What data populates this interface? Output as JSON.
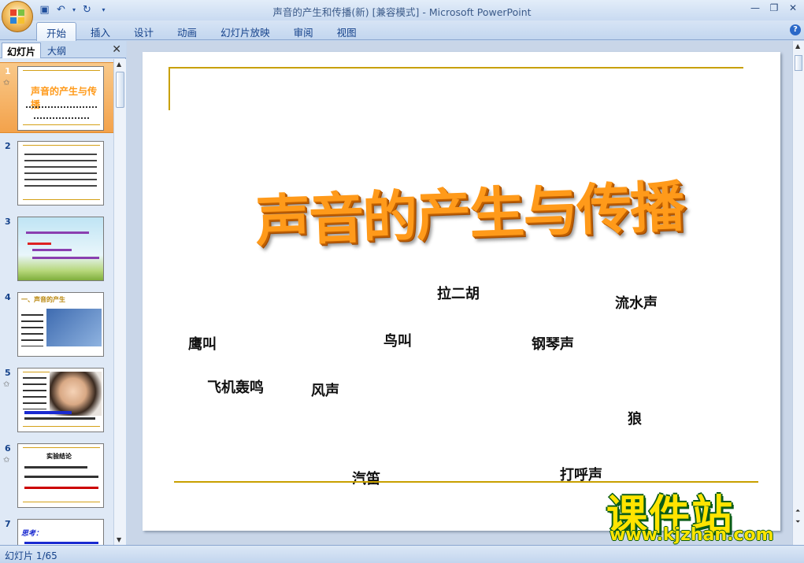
{
  "window": {
    "title": "声音的产生和传播(新) [兼容模式]",
    "app": "Microsoft PowerPoint",
    "separator": " - "
  },
  "ribbon": {
    "tabs": [
      "开始",
      "插入",
      "设计",
      "动画",
      "幻灯片放映",
      "审阅",
      "视图"
    ]
  },
  "panel": {
    "tab_slides": "幻灯片",
    "tab_outline": "大纲",
    "thumbnails": [
      {
        "num": "1",
        "title": "声音的产生与传播"
      },
      {
        "num": "2"
      },
      {
        "num": "3"
      },
      {
        "num": "4",
        "title": "一、声音的产生"
      },
      {
        "num": "5"
      },
      {
        "num": "6",
        "title": "实验结论"
      },
      {
        "num": "7",
        "title": "思考："
      }
    ]
  },
  "slide": {
    "title": "声音的产生与传播",
    "words": [
      "拉二胡",
      "流水声",
      "鹰叫",
      "鸟叫",
      "钢琴声",
      "飞机轰鸣",
      "风声",
      "狼",
      "汽笛",
      "打呼声"
    ]
  },
  "status": {
    "slide_indicator": "幻灯片 1/65"
  },
  "watermark": {
    "text": "课件站",
    "url": "www.kjzhan.com"
  },
  "colors": {
    "accent_orange": "#ff9a1a",
    "line_gold": "#c8a000",
    "watermark_yellow": "#ffe400",
    "watermark_green": "#0a5c18"
  }
}
